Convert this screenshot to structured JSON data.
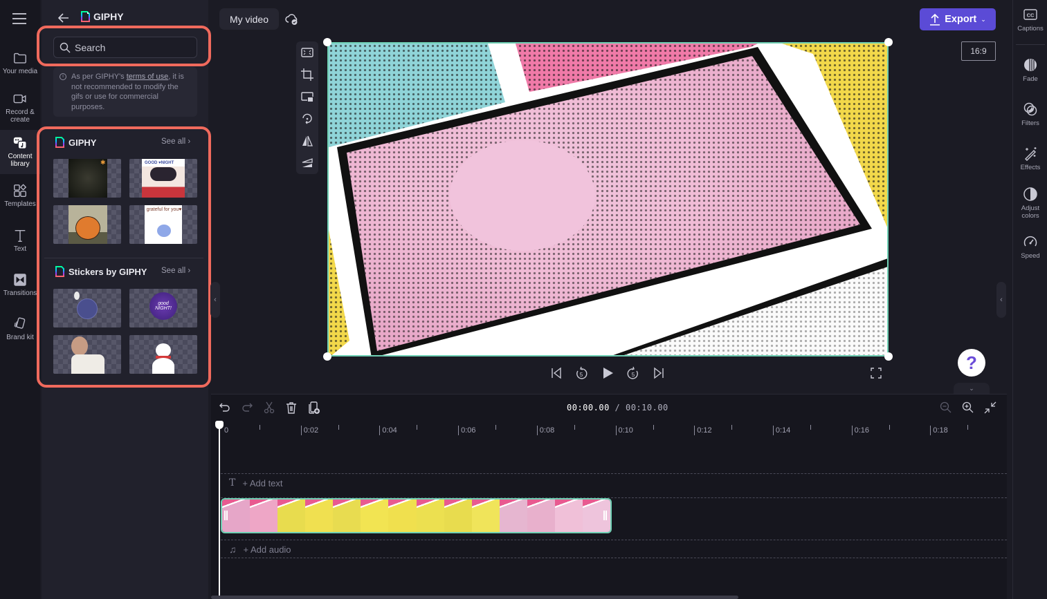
{
  "app": {
    "project_title": "My video",
    "export_label": "Export",
    "aspect_ratio": "16:9",
    "accent_color": "#5b4bd6",
    "highlight_color": "#f06a5d",
    "selection_color": "#6fd0b4"
  },
  "left_nav": {
    "items": [
      {
        "label": "Your media",
        "icon": "folder-icon"
      },
      {
        "label": "Record &\ncreate",
        "icon": "camera-icon"
      },
      {
        "label": "Content\nlibrary",
        "icon": "content-library-icon",
        "active": true
      },
      {
        "label": "Templates",
        "icon": "templates-icon"
      },
      {
        "label": "Text",
        "icon": "text-icon"
      },
      {
        "label": "Transitions",
        "icon": "transitions-icon"
      },
      {
        "label": "Brand kit",
        "icon": "brand-kit-icon"
      }
    ]
  },
  "panel": {
    "title": "GIPHY",
    "search_placeholder": "Search",
    "notice_pre": "As per GIPHY's ",
    "notice_link": "terms of use",
    "notice_post": ", it is not recommended to modify the gifs or use for commercial purposes.",
    "sections": [
      {
        "title": "GIPHY",
        "see_all": "See all",
        "items": [
          "Dark forest gif",
          "Good night couple gif",
          "Pumpkin gif",
          "Grateful for you gif"
        ]
      },
      {
        "title": "Stickers by GIPHY",
        "see_all": "See all",
        "items": [
          "Take care sticker",
          "Good night sticker",
          "Woman sticker",
          "Snowman sticker"
        ]
      }
    ]
  },
  "timeline": {
    "current_time": "00:00.00",
    "total_time": "/ 00:10.00",
    "ticks": [
      "0",
      "0:02",
      "0:04",
      "0:06",
      "0:08",
      "0:10",
      "0:12",
      "0:14",
      "0:16",
      "0:18"
    ],
    "add_text_label": "+ Add text",
    "add_audio_label": "+ Add audio"
  },
  "right_bar": {
    "items": [
      {
        "label": "Captions",
        "icon": "captions-icon"
      },
      {
        "label": "Fade",
        "icon": "fade-icon"
      },
      {
        "label": "Filters",
        "icon": "filters-icon"
      },
      {
        "label": "Effects",
        "icon": "effects-icon"
      },
      {
        "label": "Adjust\ncolors",
        "icon": "adjust-colors-icon"
      },
      {
        "label": "Speed",
        "icon": "speed-icon"
      }
    ]
  },
  "help_label": "?"
}
